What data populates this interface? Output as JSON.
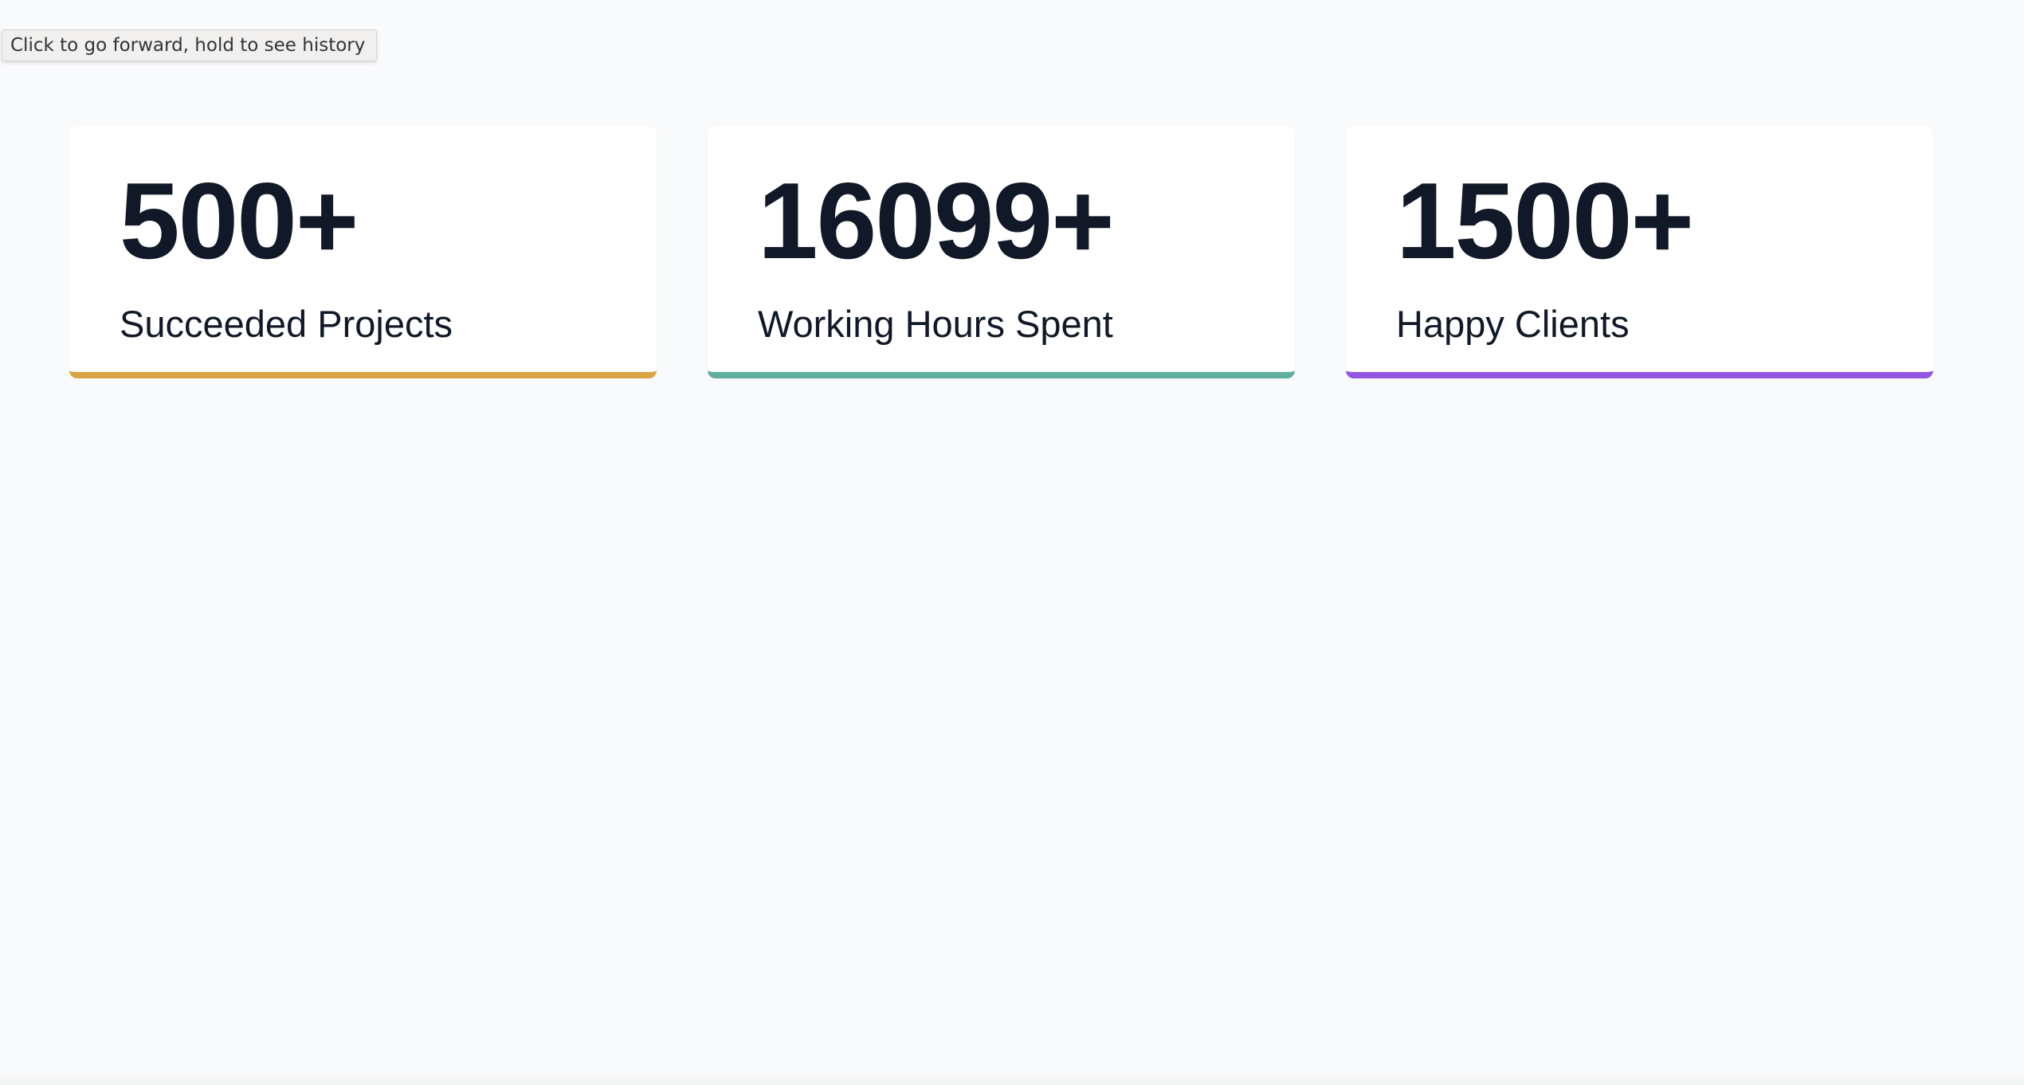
{
  "tooltip": {
    "text": "Click to go forward, hold to see history"
  },
  "stats": [
    {
      "value": "500+",
      "label": "Succeeded Projects",
      "accent": "#dba443"
    },
    {
      "value": "16099+",
      "label": "Working Hours Spent",
      "accent": "#5eaf9f"
    },
    {
      "value": "1500+",
      "label": "Happy Clients",
      "accent": "#9455e3"
    }
  ],
  "colors": {
    "background": "#f9fafb",
    "card": "#ffffff",
    "text": "#111827"
  }
}
